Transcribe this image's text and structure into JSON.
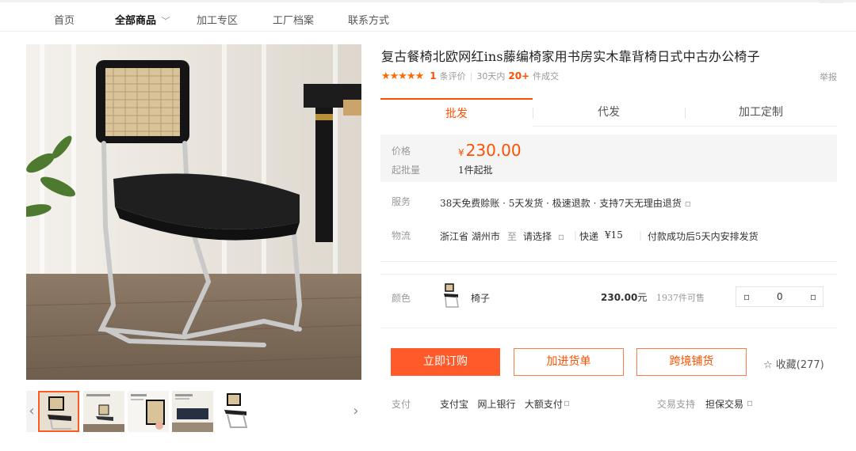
{
  "nav": {
    "items": [
      "首页",
      "全部商品",
      "加工专区",
      "工厂档案",
      "联系方式"
    ],
    "active_chevron": "﹀"
  },
  "gallery": {
    "prev_arrow": "‹",
    "next_arrow": "›",
    "selected_thumb": 0
  },
  "product": {
    "title": "复古餐椅北欧网红ins藤编椅家用书房实木靠背椅日式中古办公椅子",
    "stars": "★★★★★",
    "review_count": "1",
    "review_label": "条评价",
    "sales_period": "30天内",
    "sales_count": "20+",
    "sales_label": "件成交",
    "report": "举报"
  },
  "tabs": [
    "批发",
    "代发",
    "加工定制"
  ],
  "active_tab": 0,
  "pricing": {
    "price_label": "价格",
    "currency": "¥",
    "price": "230.00",
    "moq_label": "起批量",
    "moq": "1件起批"
  },
  "service": {
    "label": "服务",
    "text": "38天免费赊账 · 5天发货 · 极速退款 · 支持7天无理由退货",
    "icon": "▫"
  },
  "logistics": {
    "label": "物流",
    "origin": "浙江省 湖州市",
    "to": "至",
    "destination": "请选择",
    "icon": "▫",
    "express": "快递",
    "fee": "¥15",
    "note": "付款成功后5天内安排发货"
  },
  "variant": {
    "label": "颜色",
    "name": "椅子",
    "price": "230.00",
    "unit": "元",
    "stock": "1937件可售",
    "qty_minus": "▫",
    "qty": "0",
    "qty_plus": "▫"
  },
  "actions": {
    "buy": "立即订购",
    "cart": "加进货单",
    "cross_border": "跨境铺货",
    "favorite_icon": "☆",
    "favorite": "收藏(277)"
  },
  "payment": {
    "label": "支付",
    "methods": "支付宝   网上银行   大额支付",
    "icon": "▫",
    "trade_label": "交易支持",
    "trade": "担保交易"
  },
  "colors": {
    "accent": "#ff5000",
    "button": "#ff5a2a",
    "price_bg": "#f5f5f5"
  }
}
